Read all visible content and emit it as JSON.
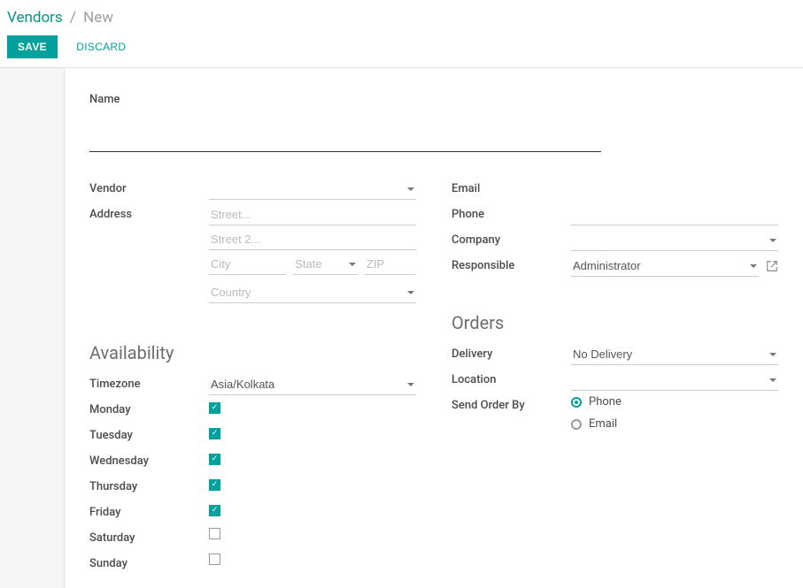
{
  "breadcrumb": {
    "root": "Vendors",
    "sep": "/",
    "current": "New"
  },
  "buttons": {
    "save": "SAVE",
    "discard": "DISCARD"
  },
  "name": {
    "label": "Name",
    "value": ""
  },
  "left": {
    "vendor": {
      "label": "Vendor",
      "value": ""
    },
    "address": {
      "label": "Address",
      "street_ph": "Street...",
      "street2_ph": "Street 2...",
      "city_ph": "City",
      "state_ph": "State",
      "zip_ph": "ZIP",
      "country_ph": "Country"
    }
  },
  "right": {
    "email": {
      "label": "Email",
      "value": ""
    },
    "phone": {
      "label": "Phone",
      "value": ""
    },
    "company": {
      "label": "Company",
      "value": ""
    },
    "responsible": {
      "label": "Responsible",
      "value": "Administrator"
    }
  },
  "availability": {
    "title": "Availability",
    "timezone": {
      "label": "Timezone",
      "value": "Asia/Kolkata"
    },
    "days": {
      "mon": {
        "label": "Monday",
        "checked": true
      },
      "tue": {
        "label": "Tuesday",
        "checked": true
      },
      "wed": {
        "label": "Wednesday",
        "checked": true
      },
      "thu": {
        "label": "Thursday",
        "checked": true
      },
      "fri": {
        "label": "Friday",
        "checked": true
      },
      "sat": {
        "label": "Saturday",
        "checked": false
      },
      "sun": {
        "label": "Sunday",
        "checked": false
      }
    }
  },
  "orders": {
    "title": "Orders",
    "delivery": {
      "label": "Delivery",
      "value": "No Delivery"
    },
    "location": {
      "label": "Location",
      "value": ""
    },
    "sendby": {
      "label": "Send Order By",
      "phone": "Phone",
      "email": "Email",
      "selected": "phone"
    }
  }
}
